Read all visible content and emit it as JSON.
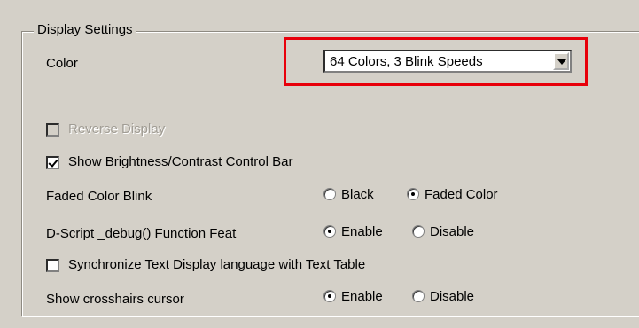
{
  "group": {
    "title": "Display Settings"
  },
  "color": {
    "label": "Color",
    "selected": "64 Colors, 3 Blink Speeds"
  },
  "reverse_display": {
    "label": "Reverse Display",
    "checked": false,
    "enabled": false
  },
  "brightness_bar": {
    "label": "Show Brightness/Contrast Control Bar",
    "checked": true
  },
  "faded_color_blink": {
    "label": "Faded Color Blink",
    "options": [
      "Black",
      "Faded Color"
    ],
    "selected": "Faded Color"
  },
  "dscript_debug": {
    "label": "D-Script  _debug() Function Feat",
    "options": [
      "Enable",
      "Disable"
    ],
    "selected": "Enable"
  },
  "sync_text": {
    "label": "Synchronize Text Display language with Text Table",
    "checked": false
  },
  "crosshairs": {
    "label": "Show crosshairs cursor",
    "options": [
      "Enable",
      "Disable"
    ],
    "selected": "Enable"
  },
  "highlight_color": "#e8000b"
}
